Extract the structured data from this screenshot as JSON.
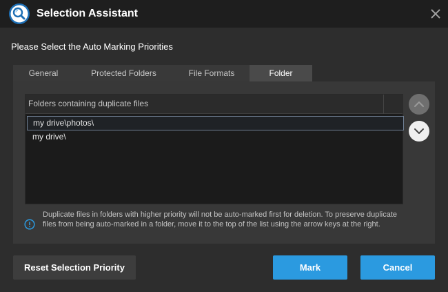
{
  "window": {
    "title": "Selection Assistant",
    "heading": "Please Select the Auto Marking Priorities"
  },
  "tabs": [
    {
      "label": "General",
      "active": false
    },
    {
      "label": "Protected Folders",
      "active": false
    },
    {
      "label": "File Formats",
      "active": false
    },
    {
      "label": "Folder",
      "active": true
    }
  ],
  "list": {
    "header": "Folders containing duplicate files",
    "rows": [
      {
        "label": "my drive\\photos\\",
        "selected": true
      },
      {
        "label": "my drive\\",
        "selected": false
      }
    ]
  },
  "info": {
    "text": "Duplicate files in folders with higher priority will not be auto-marked first for deletion. To preserve duplicate files from being auto-marked in a folder, move it to the top of the list using the arrow keys at the right."
  },
  "buttons": {
    "reset": "Reset Selection Priority",
    "mark": "Mark",
    "cancel": "Cancel"
  },
  "icons": {
    "logo": "search-magnifier-icon",
    "close": "close-icon",
    "move_up": "chevron-up-icon",
    "move_down": "chevron-down-icon",
    "info": "info-icon"
  },
  "colors": {
    "accent": "#2b9ae0",
    "background": "#2d2d2d",
    "titlebar": "#1e1e1e",
    "panel": "#383838"
  }
}
